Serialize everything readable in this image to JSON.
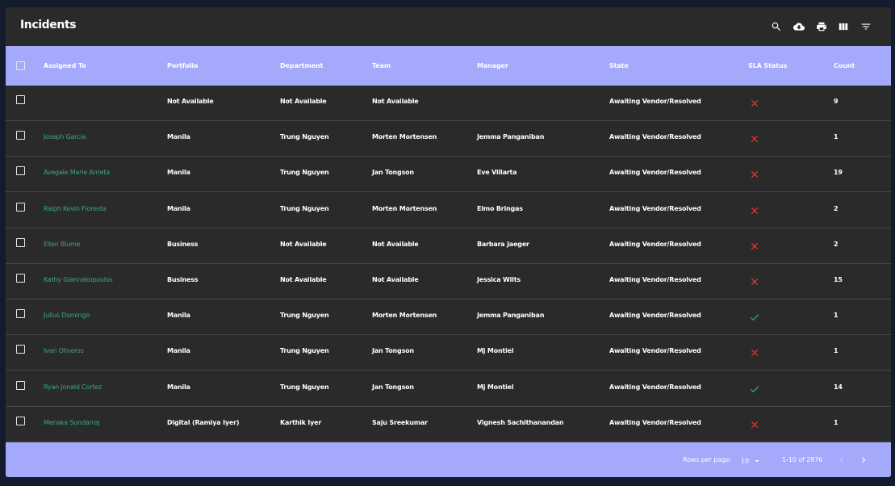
{
  "header": {
    "title": "Incidents",
    "tools": [
      {
        "icon": "search-icon"
      },
      {
        "icon": "cloud-download-icon"
      },
      {
        "icon": "print-icon"
      },
      {
        "icon": "view-columns-icon"
      },
      {
        "icon": "filter-icon"
      }
    ]
  },
  "table": {
    "columns": [
      "Assigned To",
      "Portfolio",
      "Department",
      "Team",
      "Manager",
      "State",
      "SLA Status",
      "Count"
    ],
    "rows": [
      {
        "assigned": "",
        "portfolio": "Not Available",
        "department": "Not Available",
        "team": "Not Available",
        "manager": "",
        "state": "Awaiting Vendor/Resolved",
        "sla": "breached",
        "count": "9"
      },
      {
        "assigned": "Joseph Garcia",
        "portfolio": "Manila",
        "department": "Trung Nguyen",
        "team": "Morten Mortensen",
        "manager": "Jemma Panganiban",
        "state": "Awaiting Vendor/Resolved",
        "sla": "breached",
        "count": "1"
      },
      {
        "assigned": "Avegale Marie Arrieta",
        "portfolio": "Manila",
        "department": "Trung Nguyen",
        "team": "Jan Tongson",
        "manager": "Eve Villarta",
        "state": "Awaiting Vendor/Resolved",
        "sla": "breached",
        "count": "19"
      },
      {
        "assigned": "Ralph Kevin Floresta",
        "portfolio": "Manila",
        "department": "Trung Nguyen",
        "team": "Morten Mortensen",
        "manager": "Elmo Bringas",
        "state": "Awaiting Vendor/Resolved",
        "sla": "breached",
        "count": "2"
      },
      {
        "assigned": "Ellen Blume",
        "portfolio": "Business",
        "department": "Not Available",
        "team": "Not Available",
        "manager": "Barbara Jaeger",
        "state": "Awaiting Vendor/Resolved",
        "sla": "breached",
        "count": "2"
      },
      {
        "assigned": "Kathy Giannakopoulos",
        "portfolio": "Business",
        "department": "Not Available",
        "team": "Not Available",
        "manager": "Jessica Wilts",
        "state": "Awaiting Vendor/Resolved",
        "sla": "breached",
        "count": "15"
      },
      {
        "assigned": "Julius Domingo",
        "portfolio": "Manila",
        "department": "Trung Nguyen",
        "team": "Morten Mortensen",
        "manager": "Jemma Panganiban",
        "state": "Awaiting Vendor/Resolved",
        "sla": "met",
        "count": "1"
      },
      {
        "assigned": "Ivan Oliveros",
        "portfolio": "Manila",
        "department": "Trung Nguyen",
        "team": "Jan Tongson",
        "manager": "Mj Montiel",
        "state": "Awaiting Vendor/Resolved",
        "sla": "breached",
        "count": "1"
      },
      {
        "assigned": "Ryan Jonald Cortez",
        "portfolio": "Manila",
        "department": "Trung Nguyen",
        "team": "Jan Tongson",
        "manager": "Mj Montiel",
        "state": "Awaiting Vendor/Resolved",
        "sla": "met",
        "count": "14"
      },
      {
        "assigned": "Menaka Sundarraj",
        "portfolio": "Digital (Ramiya Iyer)",
        "department": "Karthik Iyer",
        "team": "Saju Sreekumar",
        "manager": "Vignesh Sachithanandan",
        "state": "Awaiting Vendor/Resolved",
        "sla": "breached",
        "count": "1"
      }
    ]
  },
  "footer": {
    "rows_per_page_label": "Rows per page:",
    "rows_per_page_value": "10",
    "range": "1-10 of 2876"
  },
  "colors": {
    "accent": "#a4a9fc",
    "assignee": "#3da58a",
    "breached": "#e53935",
    "met": "#3da58a",
    "panel": "#2a2a2a",
    "background": "#141b2d"
  }
}
